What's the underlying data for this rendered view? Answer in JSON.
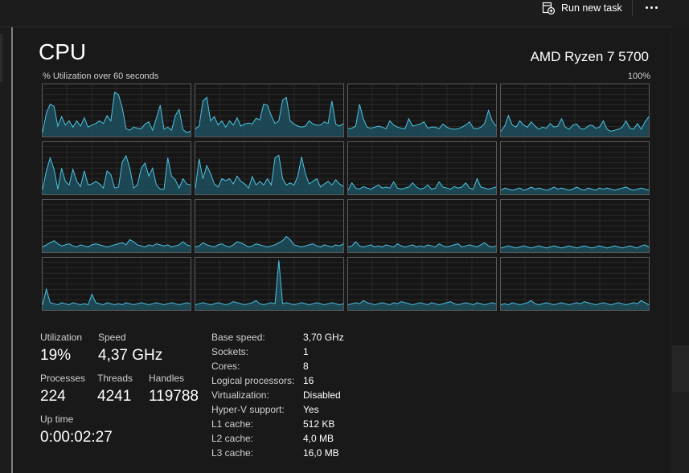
{
  "toolbar": {
    "run_new_task_label": "Run new task"
  },
  "header": {
    "title": "CPU",
    "cpu_model": "AMD Ryzen 7 5700",
    "graph_caption": "% Utilization over 60 seconds",
    "graph_max": "100%"
  },
  "colors": {
    "graph_line": "#4ec3e0",
    "graph_fill": "#1f4f5e",
    "grid_line": "#3a3a3a"
  },
  "graphs": [
    [
      8,
      45,
      62,
      58,
      20,
      38,
      22,
      30,
      18,
      30,
      20,
      36,
      18,
      22,
      25,
      30,
      25,
      40,
      30,
      85,
      80,
      55,
      15,
      12,
      18,
      16,
      15,
      24,
      28,
      12,
      35,
      60,
      14,
      18,
      12,
      40,
      52,
      13,
      8,
      10
    ],
    [
      15,
      20,
      68,
      75,
      30,
      38,
      22,
      30,
      18,
      30,
      22,
      36,
      20,
      24,
      26,
      24,
      35,
      32,
      62,
      60,
      40,
      25,
      30,
      70,
      75,
      30,
      24,
      20,
      18,
      20,
      30,
      24,
      22,
      22,
      28,
      25,
      68,
      24,
      20,
      25
    ],
    [
      15,
      16,
      20,
      62,
      34,
      18,
      16,
      18,
      20,
      18,
      15,
      30,
      22,
      18,
      16,
      15,
      34,
      20,
      22,
      24,
      28,
      16,
      18,
      18,
      15,
      24,
      18,
      15,
      14,
      15,
      18,
      22,
      28,
      16,
      15,
      18,
      25,
      50,
      30,
      20
    ],
    [
      10,
      20,
      40,
      22,
      18,
      30,
      22,
      18,
      28,
      20,
      14,
      18,
      16,
      25,
      18,
      20,
      34,
      18,
      14,
      22,
      24,
      15,
      14,
      20,
      22,
      16,
      18,
      30,
      14,
      10,
      12,
      14,
      18,
      30,
      16,
      14,
      25,
      14,
      28,
      38
    ],
    [
      10,
      45,
      70,
      48,
      10,
      50,
      25,
      18,
      48,
      25,
      15,
      45,
      18,
      20,
      25,
      20,
      12,
      45,
      38,
      12,
      14,
      62,
      74,
      50,
      12,
      18,
      50,
      60,
      35,
      50,
      18,
      10,
      10,
      70,
      35,
      28,
      12,
      30,
      20,
      18
    ],
    [
      12,
      68,
      30,
      55,
      40,
      20,
      14,
      30,
      26,
      30,
      20,
      35,
      25,
      20,
      12,
      34,
      18,
      25,
      18,
      30,
      18,
      70,
      75,
      30,
      18,
      22,
      18,
      35,
      72,
      40,
      20,
      25,
      30,
      14,
      20,
      25,
      18,
      28,
      20,
      15
    ],
    [
      8,
      22,
      12,
      10,
      15,
      12,
      10,
      14,
      18,
      12,
      14,
      12,
      24,
      12,
      10,
      12,
      14,
      22,
      14,
      10,
      12,
      18,
      10,
      12,
      24,
      14,
      12,
      10,
      15,
      12,
      14,
      22,
      12,
      10,
      30,
      14,
      12,
      10,
      12,
      14
    ],
    [
      8,
      12,
      10,
      8,
      10,
      12,
      8,
      10,
      14,
      10,
      12,
      10,
      8,
      10,
      14,
      10,
      12,
      10,
      8,
      10,
      14,
      10,
      8,
      12,
      10,
      8,
      12,
      10,
      12,
      10,
      8,
      10,
      12,
      14,
      10,
      8,
      10,
      12,
      10,
      8
    ],
    [
      10,
      14,
      18,
      22,
      16,
      12,
      14,
      16,
      12,
      10,
      14,
      12,
      10,
      14,
      16,
      14,
      12,
      10,
      12,
      14,
      16,
      18,
      14,
      24,
      20,
      14,
      12,
      10,
      14,
      12,
      16,
      14,
      12,
      14,
      10,
      12,
      14,
      20,
      14,
      12
    ],
    [
      10,
      12,
      18,
      14,
      12,
      10,
      14,
      16,
      12,
      10,
      14,
      20,
      18,
      14,
      10,
      12,
      16,
      14,
      12,
      10,
      12,
      14,
      18,
      22,
      30,
      24,
      14,
      12,
      10,
      12,
      14,
      16,
      12,
      10,
      14,
      12,
      10,
      14,
      12,
      16
    ],
    [
      10,
      12,
      20,
      12,
      10,
      12,
      14,
      10,
      12,
      10,
      14,
      12,
      10,
      16,
      12,
      10,
      12,
      14,
      10,
      12,
      10,
      14,
      12,
      10,
      16,
      12,
      10,
      12,
      14,
      16,
      10,
      12,
      14,
      12,
      10,
      14,
      18,
      12,
      10,
      12
    ],
    [
      8,
      10,
      12,
      10,
      8,
      10,
      12,
      10,
      8,
      10,
      12,
      10,
      8,
      10,
      12,
      10,
      8,
      10,
      12,
      10,
      8,
      10,
      12,
      10,
      8,
      10,
      12,
      10,
      8,
      10,
      12,
      10,
      8,
      10,
      12,
      10,
      8,
      12,
      14,
      10
    ],
    [
      10,
      40,
      14,
      12,
      10,
      14,
      12,
      10,
      14,
      12,
      10,
      12,
      10,
      30,
      14,
      12,
      10,
      14,
      12,
      10,
      12,
      10,
      14,
      12,
      10,
      12,
      14,
      12,
      10,
      12,
      14,
      12,
      10,
      12,
      14,
      12,
      10,
      12,
      14,
      12
    ],
    [
      10,
      12,
      14,
      12,
      10,
      12,
      14,
      12,
      10,
      12,
      16,
      14,
      12,
      10,
      12,
      14,
      18,
      12,
      10,
      12,
      14,
      12,
      95,
      12,
      14,
      12,
      10,
      12,
      14,
      12,
      10,
      12,
      14,
      12,
      10,
      12,
      14,
      12,
      10,
      12
    ],
    [
      10,
      12,
      14,
      12,
      18,
      14,
      12,
      10,
      12,
      14,
      12,
      10,
      14,
      12,
      16,
      14,
      12,
      10,
      12,
      14,
      12,
      10,
      14,
      12,
      10,
      12,
      14,
      16,
      12,
      10,
      12,
      14,
      12,
      10,
      14,
      12,
      10,
      12,
      14,
      12
    ],
    [
      10,
      12,
      10,
      14,
      12,
      10,
      12,
      14,
      18,
      12,
      10,
      12,
      14,
      12,
      10,
      12,
      14,
      12,
      10,
      12,
      14,
      12,
      16,
      14,
      12,
      10,
      12,
      14,
      12,
      10,
      12,
      14,
      12,
      10,
      12,
      14,
      12,
      18,
      14,
      10
    ]
  ],
  "stats": {
    "utilization": {
      "label": "Utilization",
      "value": "19%"
    },
    "speed": {
      "label": "Speed",
      "value": "4,37 GHz"
    },
    "processes": {
      "label": "Processes",
      "value": "224"
    },
    "threads": {
      "label": "Threads",
      "value": "4241"
    },
    "handles": {
      "label": "Handles",
      "value": "119788"
    },
    "uptime": {
      "label": "Up time",
      "value": "0:00:02:27"
    }
  },
  "specs": [
    {
      "key": "Base speed:",
      "value": "3,70 GHz"
    },
    {
      "key": "Sockets:",
      "value": "1"
    },
    {
      "key": "Cores:",
      "value": "8"
    },
    {
      "key": "Logical processors:",
      "value": "16"
    },
    {
      "key": "Virtualization:",
      "value": "Disabled"
    },
    {
      "key": "Hyper-V support:",
      "value": "Yes"
    },
    {
      "key": "L1 cache:",
      "value": "512 KB"
    },
    {
      "key": "L2 cache:",
      "value": "4,0 MB"
    },
    {
      "key": "L3 cache:",
      "value": "16,0 MB"
    }
  ]
}
